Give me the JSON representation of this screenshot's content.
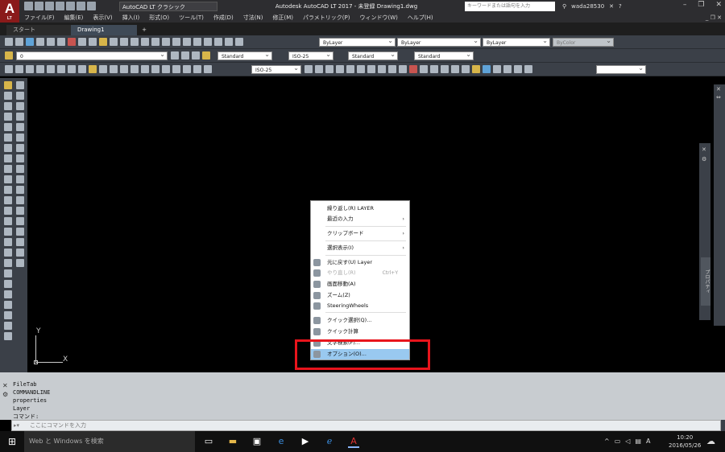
{
  "titlebar": {
    "workspace": "AutoCAD LT クラシック",
    "title": "Autodesk AutoCAD LT 2017 - 未登録    Drawing1.dwg",
    "search_placeholder": "キーワードまたは語句を入力",
    "user": "wada28530"
  },
  "menu": [
    "ファイル(F)",
    "編集(E)",
    "表示(V)",
    "挿入(I)",
    "形式(O)",
    "ツール(T)",
    "作成(D)",
    "寸法(N)",
    "修正(M)",
    "パラメトリック(P)",
    "ウィンドウ(W)",
    "ヘルプ(H)"
  ],
  "tabs": {
    "start": "スタート",
    "drawing": "Drawing1",
    "add": "+"
  },
  "toolbars": {
    "layer_by": "ByLayer",
    "linetype": "ByLayer",
    "lineweight": "ByLayer",
    "color": "ByColor",
    "layer_name": "0",
    "text_style": "Standard",
    "dim_style": "ISO-25",
    "table_style": "Standard",
    "mleader_style": "Standard",
    "dim_style2": "ISO-25"
  },
  "ucs": {
    "y": "Y",
    "x": "X"
  },
  "context_menu": [
    {
      "label": "繰り返し(R) LAYER",
      "arrow": "",
      "shortcut": "",
      "icon": "none",
      "disabled": false,
      "highlighted": false
    },
    {
      "label": "最近の入力",
      "arrow": "›",
      "shortcut": "",
      "icon": "none",
      "disabled": false,
      "highlighted": false
    },
    {
      "label": "クリップボード",
      "arrow": "›",
      "shortcut": "",
      "icon": "none",
      "disabled": false,
      "highlighted": false
    },
    {
      "label": "選択表示(I)",
      "arrow": "›",
      "shortcut": "",
      "icon": "none",
      "disabled": false,
      "highlighted": false
    },
    {
      "label": "元に戻す(U) Layer",
      "arrow": "",
      "shortcut": "",
      "icon": "undo-icon",
      "disabled": false,
      "highlighted": false
    },
    {
      "label": "やり直し(R)",
      "arrow": "",
      "shortcut": "Ctrl+Y",
      "icon": "redo-icon",
      "disabled": true,
      "highlighted": false
    },
    {
      "label": "画面移動(A)",
      "arrow": "",
      "shortcut": "",
      "icon": "pan-icon",
      "disabled": false,
      "highlighted": false
    },
    {
      "label": "ズーム(Z)",
      "arrow": "",
      "shortcut": "",
      "icon": "zoom-icon",
      "disabled": false,
      "highlighted": false
    },
    {
      "label": "SteeringWheels",
      "arrow": "",
      "shortcut": "",
      "icon": "steering-wheel-icon",
      "disabled": false,
      "highlighted": false
    },
    {
      "label": "クイック選択(Q)...",
      "arrow": "",
      "shortcut": "",
      "icon": "quick-select-icon",
      "disabled": false,
      "highlighted": false
    },
    {
      "label": "クイック計算",
      "arrow": "",
      "shortcut": "",
      "icon": "calculator-icon",
      "disabled": false,
      "highlighted": false
    },
    {
      "label": "文字検索(F)...",
      "arrow": "",
      "shortcut": "",
      "icon": "find-text-icon",
      "disabled": false,
      "highlighted": false
    },
    {
      "label": "オプション(O)...",
      "arrow": "",
      "shortcut": "",
      "icon": "options-icon",
      "disabled": false,
      "highlighted": true
    }
  ],
  "command_history": [
    "FileTab",
    "COMMANDLINE",
    "properties",
    "Layer",
    "コマンド:"
  ],
  "command_input_placeholder": "ここにコマンドを入力",
  "properties_palette": "プロパティ",
  "taskbar": {
    "search": "Web と Windows を検索",
    "time": "10:20",
    "date": "2016/05/26",
    "ime": "A"
  },
  "colors": {
    "highlight_frame": "#e8141c",
    "menu_highlight": "#99c9f0"
  }
}
